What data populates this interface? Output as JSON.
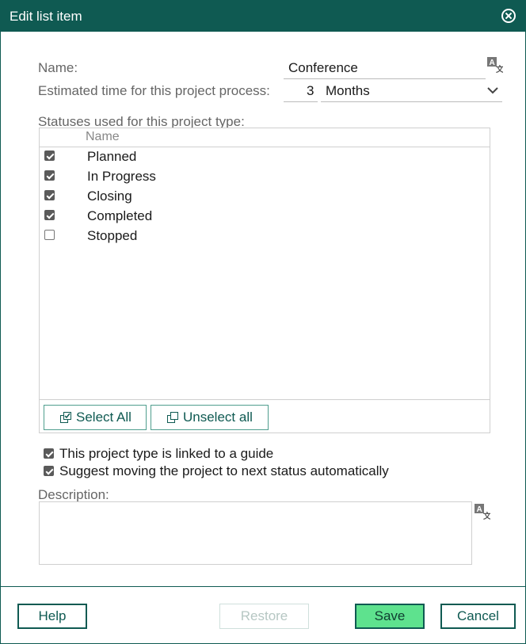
{
  "dialog": {
    "title": "Edit list item"
  },
  "form": {
    "name_label": "Name:",
    "name_value": "Conference",
    "time_label": "Estimated time for this project process:",
    "time_value": "3",
    "time_unit": "Months",
    "statuses_label": "Statuses used for this project type:",
    "column_header": "Name",
    "statuses": [
      {
        "label": "Planned",
        "checked": true
      },
      {
        "label": "In Progress",
        "checked": true
      },
      {
        "label": "Closing",
        "checked": true
      },
      {
        "label": "Completed",
        "checked": true
      },
      {
        "label": "Stopped",
        "checked": false
      }
    ],
    "select_all": "Select All",
    "unselect_all": "Unselect all",
    "options": [
      {
        "label": "This project type is linked to a guide",
        "checked": true
      },
      {
        "label": "Suggest moving the project to next status automatically",
        "checked": true
      }
    ],
    "description_label": "Description:",
    "description_value": ""
  },
  "footer": {
    "help": "Help",
    "restore": "Restore",
    "save": "Save",
    "cancel": "Cancel"
  },
  "colors": {
    "brand": "#0f5a52",
    "primary_button": "#5ee28e"
  }
}
